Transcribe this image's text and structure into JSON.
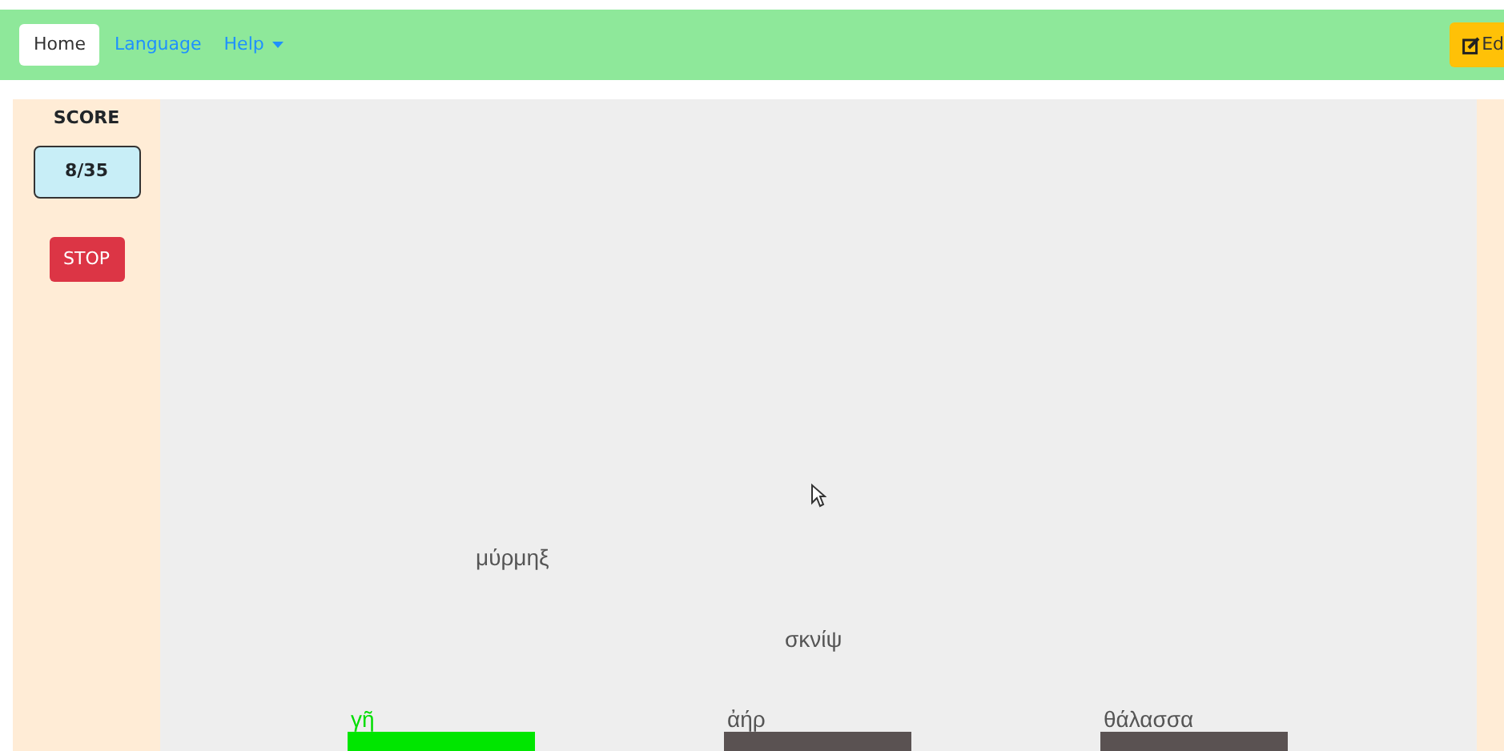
{
  "navbar": {
    "items": [
      {
        "label": "Home",
        "selected": true
      },
      {
        "label": "Language",
        "selected": false
      },
      {
        "label": "Help",
        "selected": false,
        "kind": "dropdown"
      }
    ],
    "edit_button": {
      "label": "Ed"
    }
  },
  "sidebar": {
    "score_title": "SCORE",
    "score": "8/35",
    "stop_button": "STOP"
  },
  "game": {
    "falling_words": [
      {
        "text": "μύρμηξ"
      },
      {
        "text": "σκνίψ"
      }
    ],
    "bins": [
      {
        "label": "γῆ",
        "selected": true
      },
      {
        "label": "ἀήρ",
        "selected": false
      },
      {
        "label": "θάλασσα",
        "selected": false
      }
    ]
  }
}
